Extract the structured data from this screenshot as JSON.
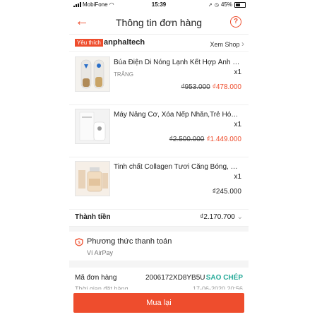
{
  "status": {
    "carrier": "MobiFone",
    "time": "15:39",
    "battery": "45%",
    "battery_level": 0.45
  },
  "header": {
    "title": "Thông tin đơn hàng",
    "back_icon": "arrow-left-icon",
    "help_icon": "question-icon"
  },
  "shop": {
    "badge": "Yêu thích",
    "name": "anphaltech",
    "view_label": "Xem Shop",
    "chevron": "›"
  },
  "items": [
    {
      "name": "Búa Điện Di Nóng Lạnh Kết Hợp Ánh Sá...",
      "variant": "TRẮNG",
      "qty": "x1",
      "old_price": "₫953.000",
      "price": "₫478.000"
    },
    {
      "name": "Máy Nâng Cơ, Xóa Nếp Nhăn,Trẻ Hóa D...",
      "variant": "",
      "qty": "x1",
      "old_price": "₫2.500.000",
      "price": "₫1.449.000"
    },
    {
      "name": "Tinh chất Collagen Tươi Căng Bóng, Ch...",
      "variant": "",
      "qty": "x1",
      "old_price": "",
      "price": "₫245.000"
    }
  ],
  "total": {
    "label": "Thành tiền",
    "value": "₫2.170.700",
    "chevron": "⌄"
  },
  "payment": {
    "title": "Phương thức thanh toán",
    "method": "Ví AirPay"
  },
  "order": {
    "code_label": "Mã đơn hàng",
    "code": "2006172XD8YB5U",
    "copy_label": "SAO CHÉP",
    "time_label": "Thời gian đặt hàng",
    "time": "17-06-2020 20:56"
  },
  "actions": {
    "rebuy_label": "Mua lại"
  },
  "colors": {
    "accent": "#ee4d2d",
    "teal": "#26aa99"
  }
}
